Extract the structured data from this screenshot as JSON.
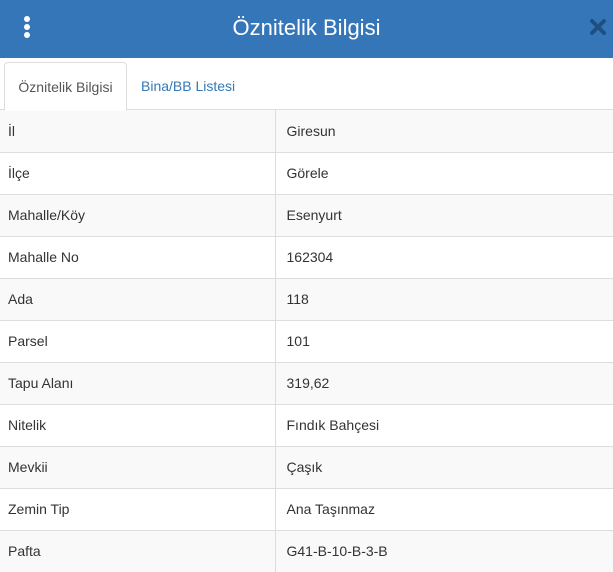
{
  "header": {
    "title": "Öznitelik Bilgisi",
    "menu_icon": "vertical-ellipsis-icon",
    "close_icon": "close-x-icon",
    "bg_color": "#3476b8"
  },
  "tabs": [
    {
      "label": "Öznitelik Bilgisi",
      "active": true
    },
    {
      "label": "Bina/BB Listesi",
      "active": false
    }
  ],
  "attributes": [
    {
      "key": "İl",
      "value": "Giresun"
    },
    {
      "key": "İlçe",
      "value": "Görele"
    },
    {
      "key": "Mahalle/Köy",
      "value": "Esenyurt"
    },
    {
      "key": "Mahalle No",
      "value": "162304"
    },
    {
      "key": "Ada",
      "value": "118"
    },
    {
      "key": "Parsel",
      "value": "101"
    },
    {
      "key": "Tapu Alanı",
      "value": "319,62"
    },
    {
      "key": "Nitelik",
      "value": "Fındık Bahçesi"
    },
    {
      "key": "Mevkii",
      "value": "Çaşık"
    },
    {
      "key": "Zemin Tip",
      "value": "Ana Taşınmaz"
    },
    {
      "key": "Pafta",
      "value": "G41-B-10-B-3-B"
    }
  ]
}
